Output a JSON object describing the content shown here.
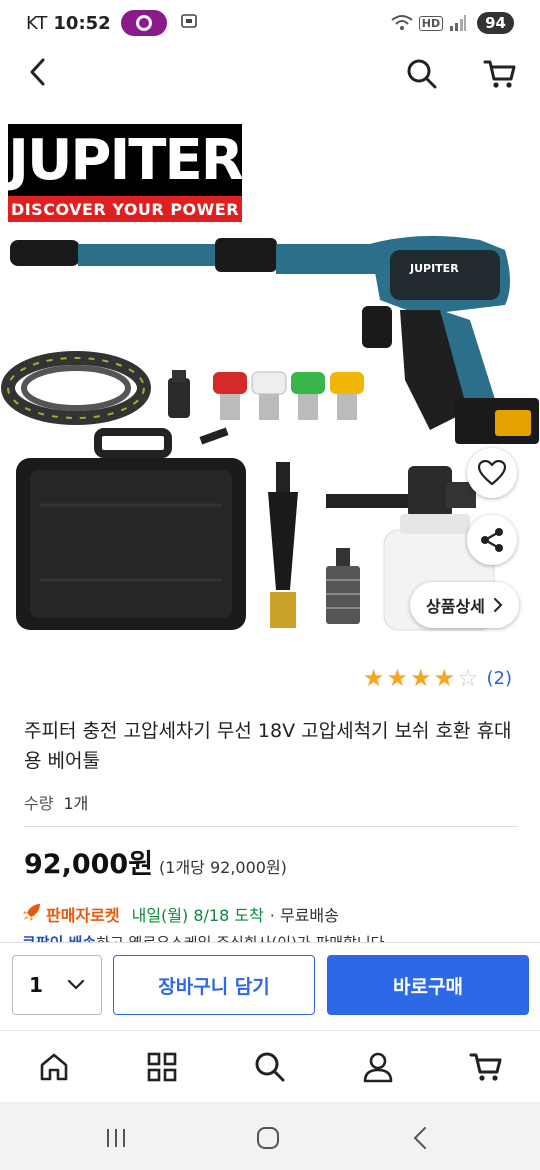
{
  "status_bar": {
    "carrier": "KT",
    "time": "10:52",
    "network": "HD",
    "battery": "94"
  },
  "header": {
    "back_icon": "chevron-left-icon",
    "search_icon": "search-icon",
    "cart_icon": "cart-icon"
  },
  "product_image": {
    "brand_name": "JUPITER",
    "brand_slogan": "DISCOVER YOUR POWER",
    "device_logo": "JUPITER",
    "detail_button": "상품상세"
  },
  "rating": {
    "stars": 4,
    "max": 5,
    "review_count": "(2)"
  },
  "product": {
    "title": "주피터 충전 고압세차기 무선 18V 고압세척기 보쉬 호환 휴대용 베어툴",
    "qty_label": "수량",
    "qty_value": "1개",
    "price": "92,000원",
    "unit_price": "(1개당 92,000원)",
    "rocket_label": "판매자로켓",
    "delivery_date": "내일(월) 8/18 도착",
    "delivery_fee": "· 무료배송",
    "seller_line_bold": "쿠팡이 배송",
    "seller_line_rest": "하고 옐로우스케일 주식회사(이)가 판매합니다"
  },
  "action_bar": {
    "quantity": "1",
    "add_to_cart": "장바구니 담기",
    "buy_now": "바로구매"
  },
  "bottom_nav": [
    "home-icon",
    "categories-icon",
    "search-icon",
    "my-account-icon",
    "cart-icon"
  ],
  "colors": {
    "accent_blue": "#2d68e6",
    "star": "#f5a623",
    "rocket_orange": "#e8590c",
    "delivery_green": "#0b8a3a"
  }
}
